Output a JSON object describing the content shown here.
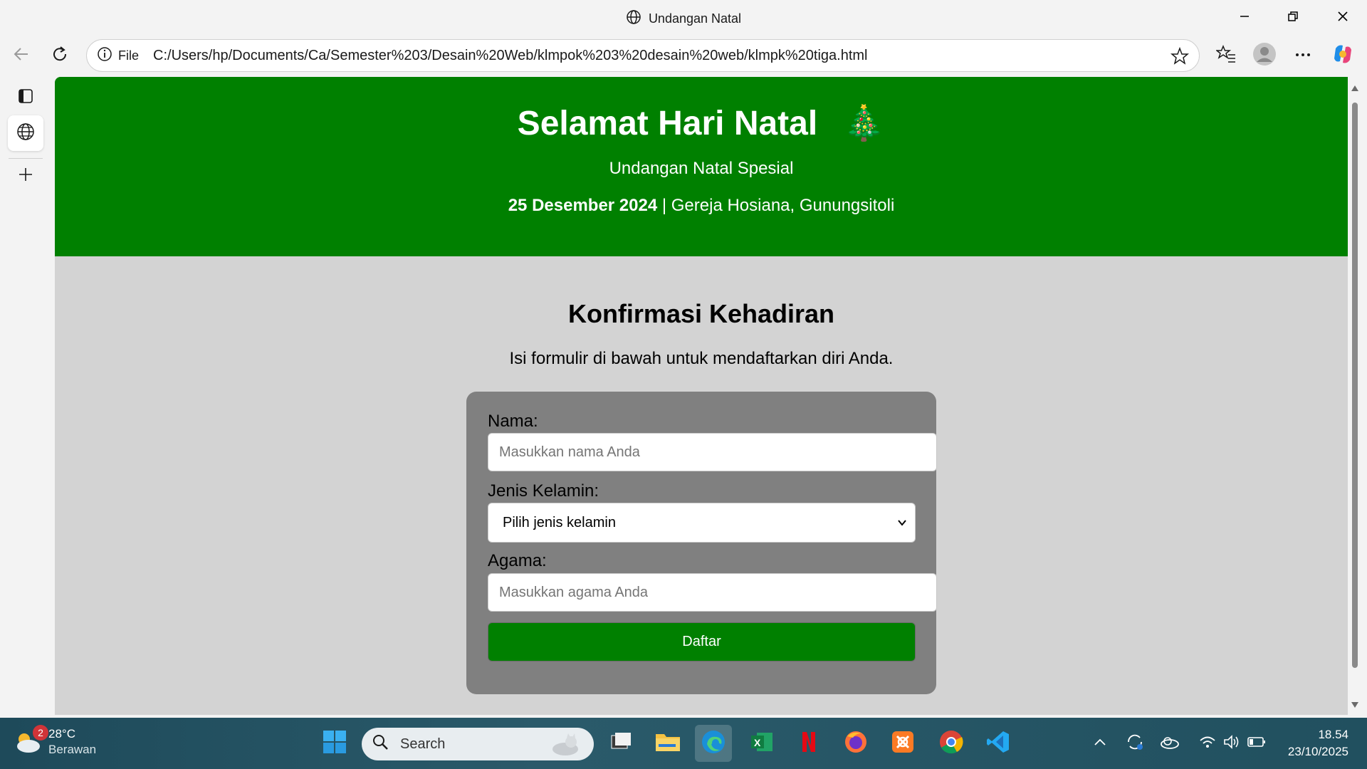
{
  "window": {
    "title": "Undangan Natal",
    "minimize_icon": "minimize-icon",
    "restore_icon": "restore-icon",
    "close_icon": "close-icon"
  },
  "toolbar": {
    "protocol_label": "File",
    "url": "C:/Users/hp/Documents/Ca/Semester%203/Desain%20Web/klmpok%203%20desain%20web/klmpk%20tiga.html"
  },
  "page": {
    "header": {
      "title": "Selamat Hari Natal",
      "emoji": "🎄",
      "subtitle": "Undangan Natal Spesial",
      "date": "25 Desember 2024",
      "location": " | Gereja Hosiana, Gunungsitoli"
    },
    "main": {
      "heading": "Konfirmasi Kehadiran",
      "intro": "Isi formulir di bawah untuk mendaftarkan diri Anda."
    },
    "form": {
      "name_label": "Nama:",
      "name_placeholder": "Masukkan nama Anda",
      "gender_label": "Jenis Kelamin:",
      "gender_selected": "Pilih jenis kelamin",
      "religion_label": "Agama:",
      "religion_placeholder": "Masukkan agama Anda",
      "submit_label": "Daftar"
    }
  },
  "taskbar": {
    "weather_temp": "28°C",
    "weather_condition": "Berawan",
    "weather_badge": "2",
    "search_label": "Search",
    "time": "18.54",
    "date": "23/10/2025"
  },
  "colors": {
    "header_green": "#008000",
    "page_bg": "#d3d3d3",
    "form_bg": "#808080"
  }
}
